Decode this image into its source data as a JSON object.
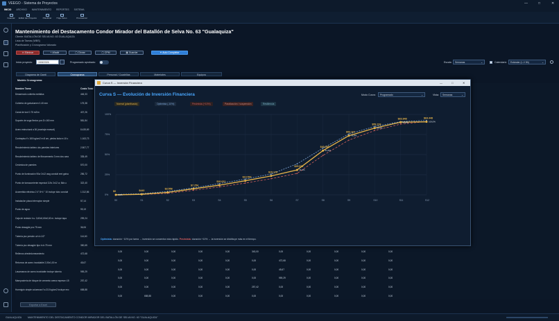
{
  "window": {
    "title": "VEEGO - Sistema de Proyectos"
  },
  "menu": [
    "INICIO",
    "ARCHIVO",
    "MANTENIMIENTO",
    "REPORTES",
    "SISTEMA"
  ],
  "ribbon": [
    {
      "label": "Guardar",
      "icon": "save-icon"
    },
    {
      "label": "Editar del Proyecto",
      "icon": "edit-icon"
    },
    {
      "label": "Planificar",
      "icon": "plan-icon"
    },
    {
      "label": "Hoja Tareo",
      "icon": "sheet-icon"
    },
    {
      "label": "Previsionar",
      "icon": "forecast-icon"
    }
  ],
  "project": {
    "title": "Mantenimiento del Destacamento Condor Mirador del Batallón de Selva No. 63 \"Gualaquiza\"",
    "client": "Cliente: BATALLÓN DE SELVA NO. 63 GUALAQUIZA",
    "tasks": "Lista de Tareas (WBS)",
    "plan": "Planificación y Cronograma Valorado"
  },
  "actions": {
    "delete": "Eliminar",
    "add": "Añadir",
    "clone": "Clonar",
    "cpm": "CPM",
    "save": "Guardar",
    "autocomplete": "Auto Completar"
  },
  "start": {
    "label": "Inicio proyecto:",
    "value": "15/8/2026",
    "approved": "Programado aprobado:"
  },
  "scale": {
    "label": "Escala",
    "value": "Semanas",
    "calendar": "Calendario",
    "calendar_value": "Estándar (L-V 8h)"
  },
  "tabs": [
    "Diagrama de Gantt",
    "Cronograma",
    "Personal / Cuadrillas",
    "Materiales",
    "Equipos"
  ],
  "grid": {
    "model_label": "Modelo Cronograma:",
    "col_name": "Nombre Tarea",
    "col_cost": "Costo Total",
    "rows": [
      {
        "name": "Desarmado cubierta metálica",
        "cost": "446,33"
      },
      {
        "name": "Cubierta de galvalumen 0.40 mm",
        "cost": "175,38"
      },
      {
        "name": "Canal de tool 0.75 m2/m",
        "cost": "407,26"
      },
      {
        "name": "Soporte de soga flexivo pvc D=160 mm",
        "cost": "581,84"
      },
      {
        "name": "Acero estructural a 36 (montaje manual)",
        "cost": "8.435,69"
      },
      {
        "name": "Contrapiso f'c 180 kg/cm2 e=8 cm, piedra bola e=10 c",
        "cost": "1.163,73"
      },
      {
        "name": "Recubrimiento tablero cks paredes interiores",
        "cost": "2.507,77"
      },
      {
        "name": "Recubrimiento tablero de fibrocemento 3 mm dos cara",
        "cost": "335,49"
      },
      {
        "name": "Cerámica de paredes",
        "cost": "570,00"
      },
      {
        "name": "Punto de iluminación 90w 2x12 awg conduit emt galva",
        "cost": "256,72"
      },
      {
        "name": "Punto de tomacorriente especial 110v 2x12 w, 8t/a u",
        "cost": "322,40"
      },
      {
        "name": "Acometida eléctrica 2 4\" 8+4 \" 10 incluye tubo conduit",
        "cost": "1.312,86"
      },
      {
        "name": "Instalación placa interruptor simple",
        "cost": "57,14"
      },
      {
        "name": "Punto de agua",
        "cost": "99,19"
      },
      {
        "name": "Caja de revisión h.s. 0,60x0,60x0,60 m. incluye tapa",
        "cost": "299,24"
      },
      {
        "name": "Punto desagüe pvc 75 mm",
        "cost": "36,06"
      },
      {
        "name": "Tubería pvc presión u/r d=1/2\"",
        "cost": "114,60"
      },
      {
        "name": "Tubería pvc desagüe tipo b d=75 mm",
        "cost": "350,65"
      },
      {
        "name": "Rellenos alrededorneamiento",
        "cost": "472,68"
      },
      {
        "name": "Retornos de acero inoxidable 2,00x1,00 m",
        "cost": "45,67"
      },
      {
        "name": "Lavamanos de acero inoxidable incluye tubería",
        "cost": "959,29"
      },
      {
        "name": "Mampostería de bloque de cemento arena espesor=15",
        "cost": "257,42"
      },
      {
        "name": "Hormigón simple columnas f'c=210 kg/cm2 incluye enc",
        "cost": "658,88"
      }
    ],
    "bottom_cells": [
      [
        "0,00",
        "0,00",
        "0,00",
        "0,00",
        "0,00",
        "343,00",
        "0,00",
        "0,00",
        "0,00",
        "0,00",
        "0,00"
      ],
      [
        "0,00",
        "0,00",
        "0,00",
        "0,00",
        "0,00",
        "0,00",
        "472,68",
        "0,00",
        "0,00",
        "0,00",
        "0,00"
      ],
      [
        "0,00",
        "0,00",
        "0,00",
        "0,00",
        "0,00",
        "0,00",
        "45,67",
        "0,00",
        "0,00",
        "0,00",
        "0,00"
      ],
      [
        "0,00",
        "0,00",
        "0,00",
        "0,00",
        "0,00",
        "0,00",
        "959,29",
        "0,00",
        "0,00",
        "0,00",
        "0,00"
      ],
      [
        "0,00",
        "0,00",
        "0,00",
        "0,00",
        "0,00",
        "257,42",
        "0,00",
        "0,00",
        "0,00",
        "0,00",
        "0,00"
      ],
      [
        "0,00",
        "658,88",
        "0,00",
        "0,00",
        "0,00",
        "0,00",
        "0,00",
        "0,00",
        "0,00",
        "0,00",
        "0,00"
      ]
    ],
    "export_btn": "Exportar a Excel"
  },
  "dialog": {
    "window_title": "Curva S — Inversión Financiera",
    "heading": "Curva S — Evolución de Inversión Financiera",
    "mode_label": "Modo Curva:",
    "mode_value": "Programado",
    "view_label": "Vista:",
    "view_value": "Semanas",
    "legend": [
      {
        "label": "Normal (planificado)",
        "color": "#e8b54a"
      },
      {
        "label": "Optimista (-10%)",
        "color": "#7fa7d8"
      },
      {
        "label": "Pesimista (+10%)",
        "color": "#d0605c"
      },
      {
        "label": "Paralización / suspensión",
        "color": "#c86a5c"
      },
      {
        "label": "Resiliencia",
        "color": "#7fb3c9"
      }
    ],
    "note_opt_label": "Optimista:",
    "note_opt": "duración −10% por tarea → inversión se concentra más rápido.",
    "note_pes_label": "Pesimista:",
    "note_pes": "duración +10% → la inversión se distribuye más en el tiempo."
  },
  "chart_data": {
    "type": "line",
    "x": [
      "S0",
      "S1",
      "S2",
      "S3",
      "S4",
      "S5",
      "S6",
      "S7",
      "S8",
      "S9",
      "S10",
      "S11",
      "S12"
    ],
    "y_ticks": [
      "0%",
      "25%",
      "50%",
      "75%",
      "100%"
    ],
    "ylim": [
      0,
      100
    ],
    "series": [
      {
        "name": "Normal (planificado)",
        "values": [
          0,
          0.7,
          3.0,
          7.5,
          12.0,
          17.5,
          23.5,
          30.9,
          55.0,
          73.5,
          83.0,
          90.3,
          90.8
        ]
      },
      {
        "name": "Optimista (-10%)",
        "values": [
          0.5,
          1.4,
          4.2,
          8.7,
          14.0,
          19.6,
          25.8,
          38.5,
          58.0,
          75.6,
          85.0,
          91.0,
          92.6
        ]
      },
      {
        "name": "Pesimista (+10%)",
        "values": [
          0,
          0.4,
          1.9,
          5.6,
          9.8,
          14.6,
          20.1,
          26.6,
          49.0,
          68.0,
          80.0,
          88.0,
          91.0
        ]
      }
    ],
    "point_labels": [
      "$0",
      "$440",
      "$3.558",
      "$7.254",
      "$10.021",
      "$14.597",
      "$19.178",
      "$25.572",
      "$40.606",
      "$53.167",
      "$59.193",
      "$63.848",
      "$64.448"
    ],
    "pct_labels": [
      "0,0%",
      "",
      "",
      "",
      "",
      "",
      "",
      "41,3%",
      "61,4%",
      "76,9%",
      "86,6%",
      "94,8%",
      "100,0%"
    ]
  },
  "status": {
    "project": "GUALAQUIZA",
    "path": "MANTENIMIENTO DEL DESTACAMENTO CONDOR MIRADOR DEL BATALLÓN DE SELVA NO. 63 \"GUALAQUIZA\""
  }
}
